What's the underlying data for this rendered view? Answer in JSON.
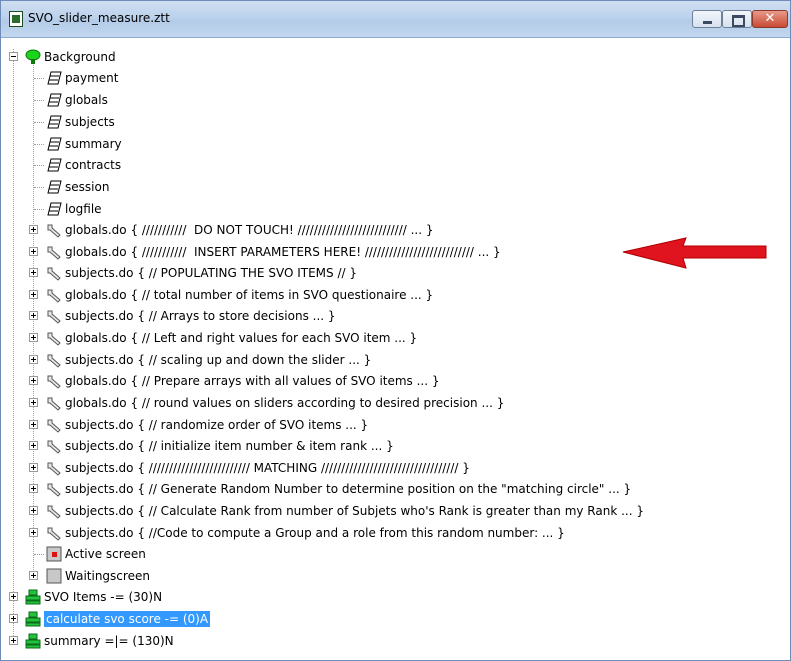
{
  "window": {
    "title": "SVO_slider_measure.ztt"
  },
  "tree": {
    "background_label": "Background",
    "tables": [
      "payment",
      "globals",
      "subjects",
      "summary",
      "contracts",
      "session",
      "logfile"
    ],
    "programs": [
      "globals.do { ///////////  DO NOT TOUCH! /////////////////////////// ... }",
      "globals.do { ///////////  INSERT PARAMETERS HERE! /////////////////////////// ... }",
      "subjects.do { // POPULATING THE SVO ITEMS // }",
      "globals.do { // total number of items in SVO questionaire ... }",
      "subjects.do { // Arrays to store decisions ... }",
      "globals.do { // Left and right values for each SVO item ... }",
      "subjects.do { // scaling up and down the slider ... }",
      "globals.do { // Prepare arrays with all values of SVO items ... }",
      "globals.do { // round values on sliders according to desired precision ... }",
      "subjects.do { // randomize order of SVO items ... }",
      "subjects.do { // initialize item number & item rank ... }",
      "subjects.do { ///////////////////////// MATCHING ////////////////////////////////// }",
      "subjects.do { // Generate Random Number to determine position on the \"matching circle\" ... }",
      "subjects.do { // Calculate Rank from number of Subjets who's Rank is greater than my Rank ... }",
      "subjects.do { //Code to compute a Group and a role from this random number: ... }"
    ],
    "active_screen_label": "Active screen",
    "waiting_screen_label": "Waitingscreen",
    "stages": [
      {
        "label": "SVO Items -= (30)N",
        "selected": false
      },
      {
        "label": "calculate svo score -= (0)A",
        "selected": true
      },
      {
        "label": "summary =|= (130)N",
        "selected": false
      }
    ]
  },
  "icons": {
    "background": "green-lamp-icon",
    "table": "table-sheets-icon",
    "program": "wrench-icon",
    "active_screen": "active-screen-icon",
    "waiting_screen": "waiting-screen-icon",
    "stage": "stage-icon"
  },
  "colors": {
    "selection": "#3399ff",
    "arrow": "#e0141e",
    "stage": "#22c23a"
  }
}
